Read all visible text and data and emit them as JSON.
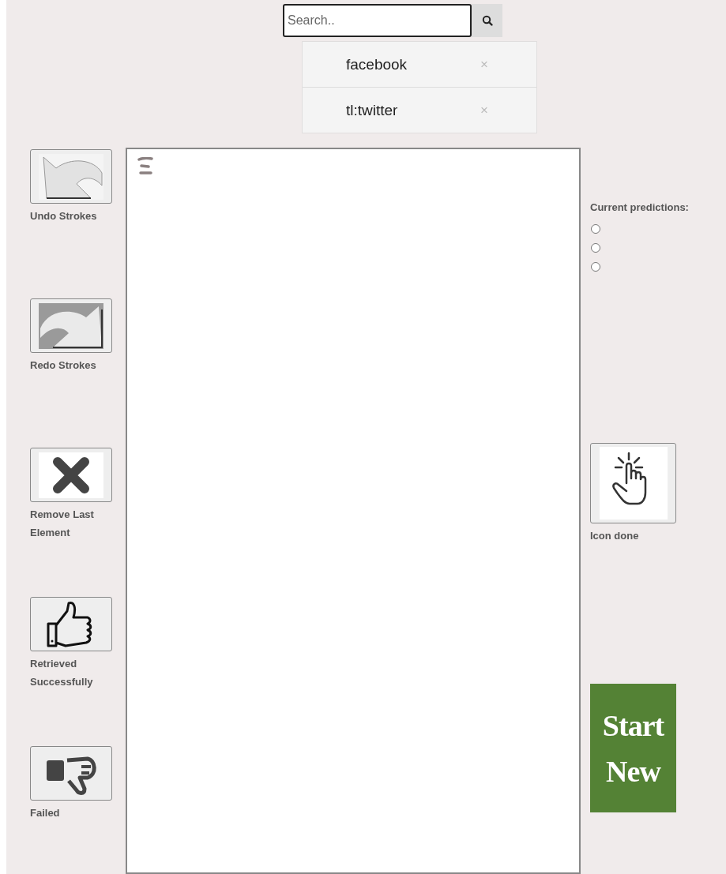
{
  "search": {
    "placeholder": "Search.."
  },
  "suggestions": [
    {
      "label": "facebook",
      "remove": "×"
    },
    {
      "label": "tl:twitter",
      "remove": "×"
    }
  ],
  "tools": [
    {
      "kind": "undo",
      "label": "Undo Strokes"
    },
    {
      "kind": "redo",
      "label": "Redo Strokes"
    },
    {
      "kind": "remove",
      "label": "Remove Last Element"
    },
    {
      "kind": "success",
      "label": "Retrieved Successfully"
    },
    {
      "kind": "failed",
      "label": "Failed"
    }
  ],
  "predictions": {
    "title": "Current predictions:",
    "options": [
      {
        "selected": false
      },
      {
        "selected": false
      },
      {
        "selected": false
      }
    ]
  },
  "icon_done": {
    "label": "Icon done"
  },
  "start_new": {
    "line_1": "Start",
    "line_2": "New"
  }
}
